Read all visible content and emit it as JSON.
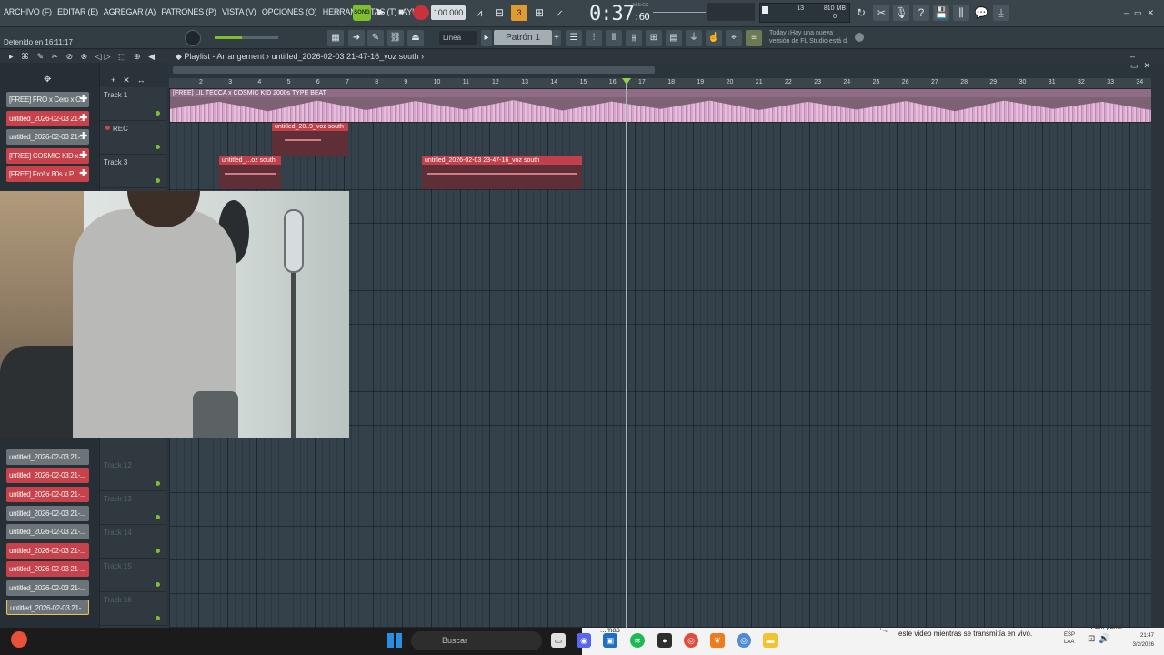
{
  "menu": [
    "ARCHIVO (F)",
    "EDITAR (E)",
    "AGREGAR (A)",
    "PATRONES (P)",
    "VISTA (V)",
    "OPCIONES (O)",
    "HERRAMIENTAS (T)",
    "AYUDA"
  ],
  "status_line": "Detenido en 16:11:17",
  "transport": {
    "song_label": "SONG",
    "tempo": "100.000",
    "time_main": "0:37",
    "time_sub": ":60",
    "time_label": "M:S:CS"
  },
  "cpu": {
    "val1": "13",
    "mem": "810 MB",
    "val3": "0"
  },
  "toolbar2": {
    "snap": "Línea",
    "pattern": "Patrón 1"
  },
  "news": {
    "line1": "Today ¡Hay una nueva",
    "line2": "versión de FL Studio está d."
  },
  "playlist": {
    "title": "Playlist - Arrangement",
    "separator": "›",
    "current": "untitled_2026-02-03 21-47-16_voz south",
    "end_arrow": "›"
  },
  "picker": [
    {
      "label": "[FREE] FRO x Cero x C...",
      "color": "gray"
    },
    {
      "label": "untitled_2026-02-03 21-...",
      "color": "red"
    },
    {
      "label": "untitled_2026-02-03 21-...",
      "color": "gray"
    },
    {
      "label": "[FREE] COSMIC KID x...",
      "color": "red"
    },
    {
      "label": "[FREE] Fro! x 80s x P...",
      "color": "red"
    },
    {
      "label": "untitled_2026-02-03 21-...",
      "color": "gray"
    },
    {
      "label": "untitled_2026-02-03 21-...",
      "color": "red"
    },
    {
      "label": "untitled_2026-02-03 21-...",
      "color": "red"
    },
    {
      "label": "untitled_2026-02-03 21-...",
      "color": "gray"
    },
    {
      "label": "untitled_2026-02-03 21-...",
      "color": "gray"
    },
    {
      "label": "untitled_2026-02-03 21-...",
      "color": "red"
    },
    {
      "label": "untitled_2026-02-03 21-...",
      "color": "red"
    },
    {
      "label": "untitled_2026-02-03 21-...",
      "color": "gray"
    },
    {
      "label": "untitled_2026-02-03 21-...",
      "color": "gray"
    },
    {
      "label": "untitled_2026-02-03 21-...",
      "color": "red"
    }
  ],
  "tracks": {
    "t1": "Track 1",
    "rec": "REC",
    "t3": "Track 3",
    "t12": "Track 12",
    "t13": "Track 13",
    "t14": "Track 14",
    "t15": "Track 15",
    "t16": "Track 16"
  },
  "ruler": [
    "2",
    "3",
    "4",
    "5",
    "6",
    "7",
    "8",
    "9",
    "10",
    "11",
    "12",
    "13",
    "14",
    "15",
    "16",
    "17",
    "18",
    "19",
    "20",
    "21",
    "22",
    "23",
    "24",
    "25",
    "26",
    "27",
    "28",
    "29",
    "30",
    "31",
    "32",
    "33",
    "34"
  ],
  "clips": {
    "beat": "[FREE] LIL TECCA x COSMIC KID 2000s TYPE BEAT",
    "c2": "untitled_20..9_voz south",
    "c3": "untitled_...oz south",
    "c4": "untitled_2026-02-03 23-47-16_voz south"
  },
  "taskbar": {
    "search": "Buscar",
    "mas": "...más",
    "notification": "este video mientras se transmitía en vivo.",
    "abrir": "Abrir panel",
    "lang1": "ESP",
    "lang2": "LAA",
    "time": "21:47",
    "date": "3/2/2026"
  },
  "colors": {
    "accent_green": "#7fbf2d",
    "clip_red": "#c7424b",
    "beat_pink": "#8f6b86"
  }
}
